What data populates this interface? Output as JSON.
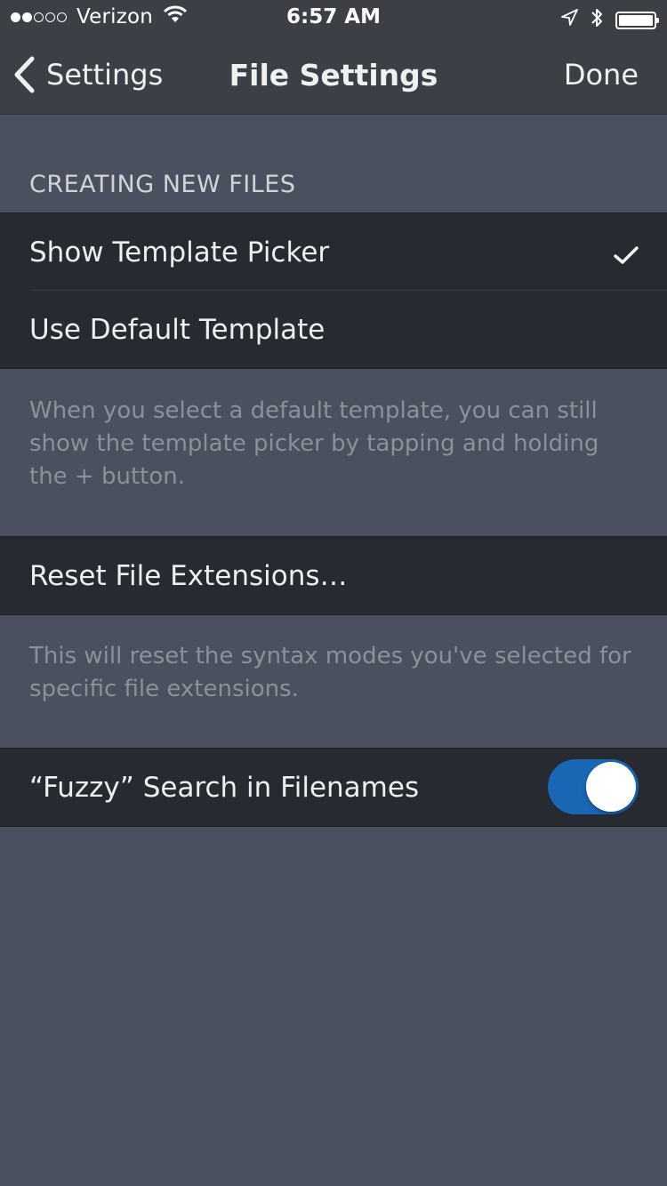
{
  "status_bar": {
    "carrier": "Verizon",
    "time": "6:57 AM",
    "signal_filled": 2,
    "signal_total": 5,
    "icons": [
      "wifi-icon",
      "location-arrow-icon",
      "bluetooth-icon",
      "battery-icon"
    ]
  },
  "nav": {
    "back_label": "Settings",
    "title": "File Settings",
    "done_label": "Done"
  },
  "section_creating": {
    "header": "CREATING NEW FILES",
    "options": [
      {
        "label": "Show Template Picker",
        "checked": true
      },
      {
        "label": "Use Default Template",
        "checked": false
      }
    ],
    "footer": "When you select a default template, you can still show the template picker by tapping and holding the + button."
  },
  "section_reset": {
    "label": "Reset File Extensions…",
    "footer": "This will reset the syntax modes you've selected for specific file extensions."
  },
  "section_fuzzy": {
    "label": "“Fuzzy” Search in Filenames",
    "enabled": true
  },
  "colors": {
    "background": "#4a505e",
    "bar": "#3b3f46",
    "cell": "#272a30",
    "toggle_on": "#1967b5"
  }
}
